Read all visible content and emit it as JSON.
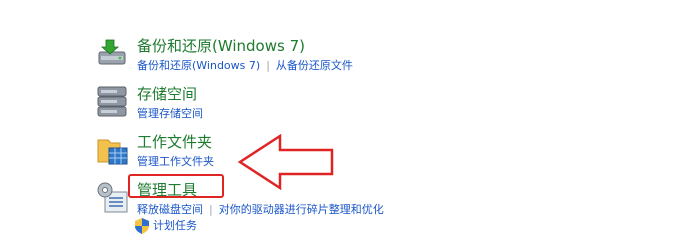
{
  "items": [
    {
      "title": "备份和还原(Windows 7)",
      "links": [
        "备份和还原(Windows 7)",
        "从备份还原文件"
      ]
    },
    {
      "title": "存储空间",
      "links": [
        "管理存储空间"
      ]
    },
    {
      "title": "工作文件夹",
      "links": [
        "管理工作文件夹"
      ]
    },
    {
      "title": "管理工具",
      "links": [
        "释放磁盘空间",
        "对你的驱动器进行碎片整理和优化"
      ],
      "sublink": "计划任务"
    }
  ],
  "annotation": {
    "highlight_color": "#e02424"
  },
  "icons": {
    "backup": "backup-restore-icon",
    "storage": "storage-spaces-icon",
    "work_folders": "work-folders-icon",
    "admin_tools": "admin-tools-icon",
    "shield": "uac-shield-icon"
  }
}
